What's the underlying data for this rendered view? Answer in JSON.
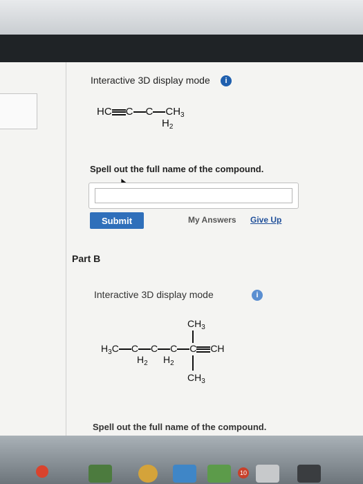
{
  "part_a": {
    "mode_label": "Interactive 3D display mode",
    "info_icon": "i",
    "formula": {
      "hc": "HC",
      "c1": "C",
      "c2": "C",
      "ch": "CH",
      "ch_sub": "3",
      "h": "H",
      "h_sub": "2"
    },
    "prompt": "Spell out the full name of the compound.",
    "answer_value": "",
    "submit_label": "Submit",
    "my_answers_label": "My Answers",
    "give_up_label": "Give Up"
  },
  "part_b": {
    "heading": "Part B",
    "mode_label": "Interactive 3D display mode",
    "info_icon": "i",
    "formula": {
      "h3c_h": "H",
      "h3c_sub": "3",
      "h3c_c": "C",
      "c": "C",
      "ch_top": "CH",
      "ch_top_sub": "3",
      "ch_bot": "CH",
      "ch_bot_sub": "3",
      "h": "H",
      "h_sub": "2",
      "chterm": "C",
      "ch_end": "CH"
    },
    "prompt": "Spell out the full name of the compound."
  },
  "taskbar": {
    "badge_count": "10"
  },
  "colors": {
    "accent": "#2f6fba",
    "dark_band": "#1f2326",
    "link": "#1f4f9a"
  }
}
